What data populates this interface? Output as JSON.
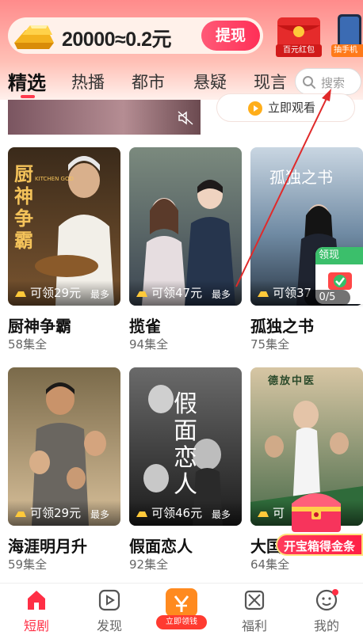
{
  "banner": {
    "reward_text": "20000≈0.2元",
    "withdraw_label": "提现",
    "red_packet_label": "百元红包",
    "phone_label": "抽手机"
  },
  "tabs": [
    {
      "label": "精选",
      "active": true
    },
    {
      "label": "热播",
      "active": false
    },
    {
      "label": "都市",
      "active": false
    },
    {
      "label": "悬疑",
      "active": false
    },
    {
      "label": "现言",
      "active": false
    }
  ],
  "search": {
    "placeholder": "搜索"
  },
  "hero": {
    "watch_label": "立即观看"
  },
  "dramas": [
    {
      "title": "厨神争霸",
      "episodes": "58集全",
      "reward": "可领29元",
      "max_label": "最多",
      "poster_title": "厨神争霸",
      "poster_subtitle": "KITCHEN GOD"
    },
    {
      "title": "揽雀",
      "episodes": "94集全",
      "reward": "可领47元",
      "max_label": "最多"
    },
    {
      "title": "孤独之书",
      "episodes": "75集全",
      "reward": "可领37",
      "max_label": "",
      "poster_title": "孤独之书"
    },
    {
      "title": "海涯明月升",
      "episodes": "59集全",
      "reward": "可领29元",
      "max_label": "最多"
    },
    {
      "title": "假面恋人",
      "episodes": "92集全",
      "reward": "可领46元",
      "max_label": "最多",
      "poster_title": "假面恋人"
    },
    {
      "title": "大国",
      "episodes": "64集全",
      "reward": "可",
      "max_label": "",
      "poster_title_top": "德放中医"
    }
  ],
  "widgets": {
    "claim_label": "领现",
    "claim_progress": "0/5",
    "chest_label": "开宝箱得金条"
  },
  "bottom_nav": [
    {
      "label": "短剧",
      "icon": "home-icon",
      "active": true
    },
    {
      "label": "发现",
      "icon": "play-square-icon",
      "active": false
    },
    {
      "label": "",
      "icon": "money-bag-icon",
      "center_label": "立即领钱",
      "active": false
    },
    {
      "label": "福利",
      "icon": "gift-box-icon",
      "active": false
    },
    {
      "label": "我的",
      "icon": "smile-face-icon",
      "active": false
    }
  ],
  "colors": {
    "accent": "#ff2f45",
    "tab_underline": "#ff3b4f",
    "claim_green": "#3bbf6b"
  }
}
